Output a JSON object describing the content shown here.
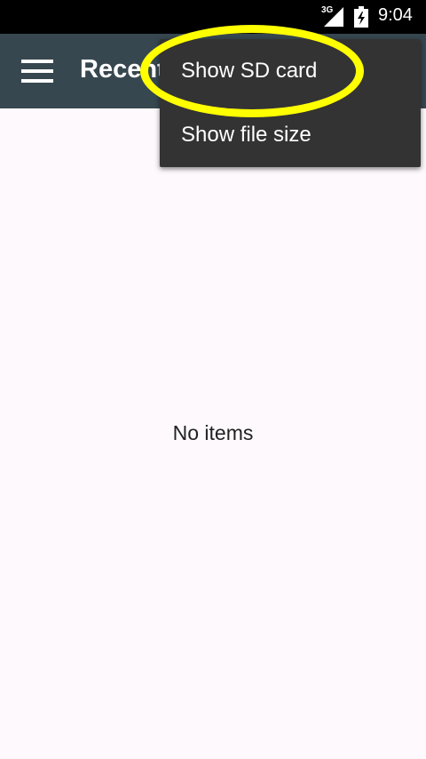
{
  "status_bar": {
    "network": "3G",
    "time": "9:04"
  },
  "toolbar": {
    "title": "Recent"
  },
  "overflow_menu": {
    "items": [
      {
        "label": "Show SD card"
      },
      {
        "label": "Show file size"
      }
    ]
  },
  "content": {
    "empty_text": "No items"
  },
  "colors": {
    "toolbar": "#37474f",
    "menu": "#333333",
    "highlight": "#ffff00",
    "background": "#fdf9fc"
  }
}
